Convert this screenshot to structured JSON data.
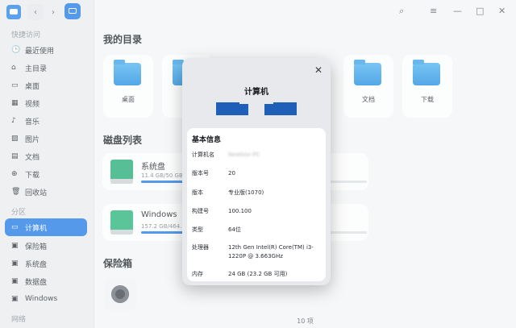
{
  "sidebar": {
    "quick_access_label": "快捷访问",
    "items_quick": [
      "最近使用",
      "主目录",
      "桌面",
      "视频",
      "音乐",
      "图片",
      "文档",
      "下载",
      "回收站"
    ],
    "partition_label": "分区",
    "items_partition": [
      "计算机",
      "保险箱",
      "系统盘",
      "数据盘",
      "Windows"
    ],
    "network_label": "网络"
  },
  "main": {
    "my_dirs_title": "我的目录",
    "tiles": [
      {
        "label": "桌面"
      },
      {
        "label": "文档"
      },
      {
        "label": "下载"
      }
    ],
    "disks_title": "磁盘列表",
    "disks": [
      {
        "name": "系统盘",
        "size": "11.4 GB/50 GB",
        "usage": 0.23
      },
      {
        "name": "Windows",
        "size": "157.2 GB/464.7",
        "usage": 0.34
      }
    ],
    "vault_title": "保险箱",
    "status": "10 项"
  },
  "dialog": {
    "title": "计算机",
    "section": "基本信息",
    "rows": [
      {
        "k": "计算机名",
        "v": "Newbox-PC"
      },
      {
        "k": "版本号",
        "v": "20"
      },
      {
        "k": "版本",
        "v": "专业版(1070)"
      },
      {
        "k": "构建号",
        "v": "100.100"
      },
      {
        "k": "类型",
        "v": "64位"
      },
      {
        "k": "处理器",
        "v": "12th Gen Intel(R) Core(TM) i3-1220P @ 3.663GHz"
      },
      {
        "k": "内存",
        "v": "24 GB (23.2 GB 可用)"
      }
    ]
  },
  "colors": {
    "accent": "#1f7ae6",
    "brand_logo": "#1f5fb8"
  }
}
